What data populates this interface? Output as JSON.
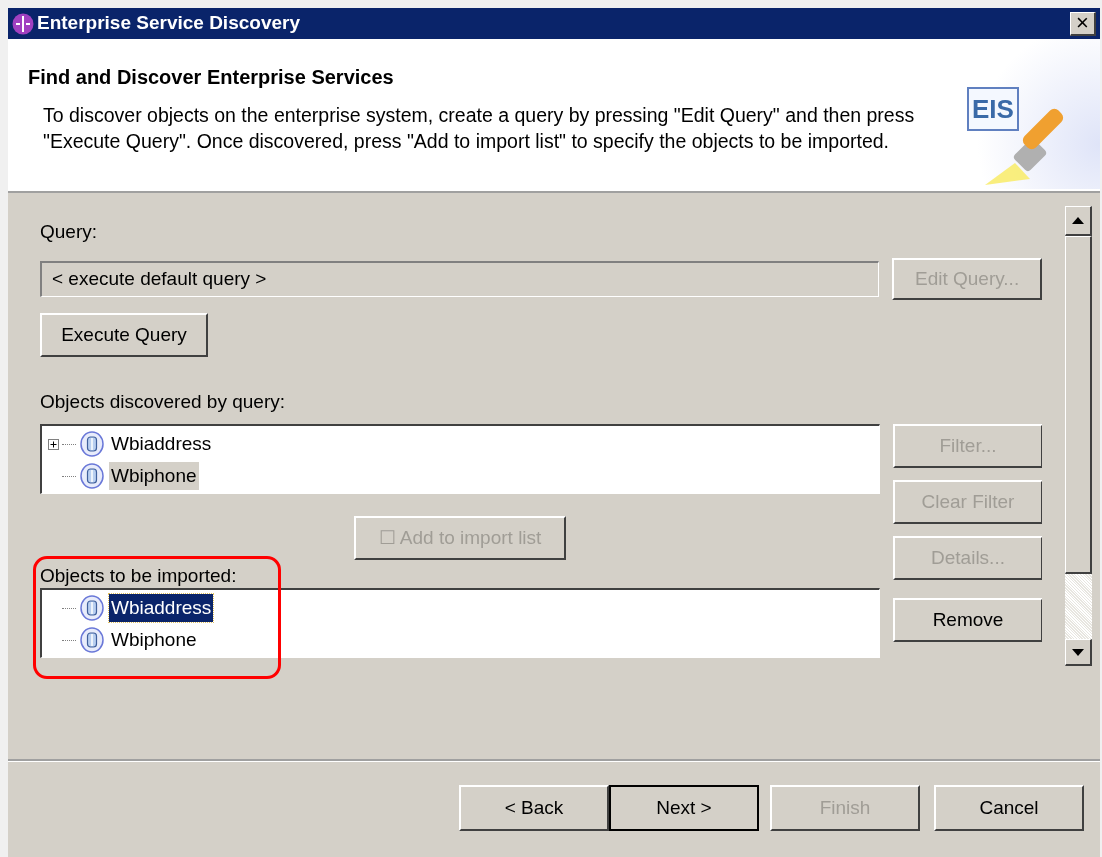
{
  "window": {
    "title": "Enterprise Service Discovery"
  },
  "header": {
    "title": "Find and Discover Enterprise Services",
    "description": "To discover objects on the enterprise system, create a query by pressing \"Edit Query\" and then press \"Execute Query\". Once discovered, press \"Add to import list\" to specify the objects to be imported.",
    "logo_text": "EIS"
  },
  "query": {
    "label": "Query:",
    "value": "< execute default query >",
    "edit_button": {
      "label": "Edit Query...",
      "disabled": true
    },
    "execute_button": {
      "label": "Execute Query",
      "disabled": false
    }
  },
  "discovered": {
    "label": "Objects discovered by query:",
    "focused": false,
    "items": [
      {
        "label": "Wbiaddress",
        "expandable": true,
        "selected": false
      },
      {
        "label": "Wbiphone",
        "expandable": false,
        "selected": true
      }
    ]
  },
  "side_buttons": [
    {
      "label": "Filter...",
      "disabled": true
    },
    {
      "label": "Clear Filter",
      "disabled": true
    },
    {
      "label": "Details...",
      "disabled": true
    }
  ],
  "add_button": {
    "label": "☐ Add to import list",
    "disabled": true
  },
  "to_import": {
    "label": "Objects to be imported:",
    "focused": true,
    "items": [
      {
        "label": "Wbiaddress",
        "expandable": false,
        "selected": true
      },
      {
        "label": "Wbiphone",
        "expandable": false,
        "selected": false
      }
    ]
  },
  "remove_button": {
    "label": "Remove",
    "disabled": false
  },
  "footer_buttons": [
    {
      "label": "< Back",
      "disabled": false,
      "default": false
    },
    {
      "label": "Next >",
      "disabled": false,
      "default": true
    },
    {
      "label": "Finish",
      "disabled": true,
      "default": false
    },
    {
      "label": "Cancel",
      "disabled": false,
      "default": false
    }
  ],
  "close_label": "×"
}
